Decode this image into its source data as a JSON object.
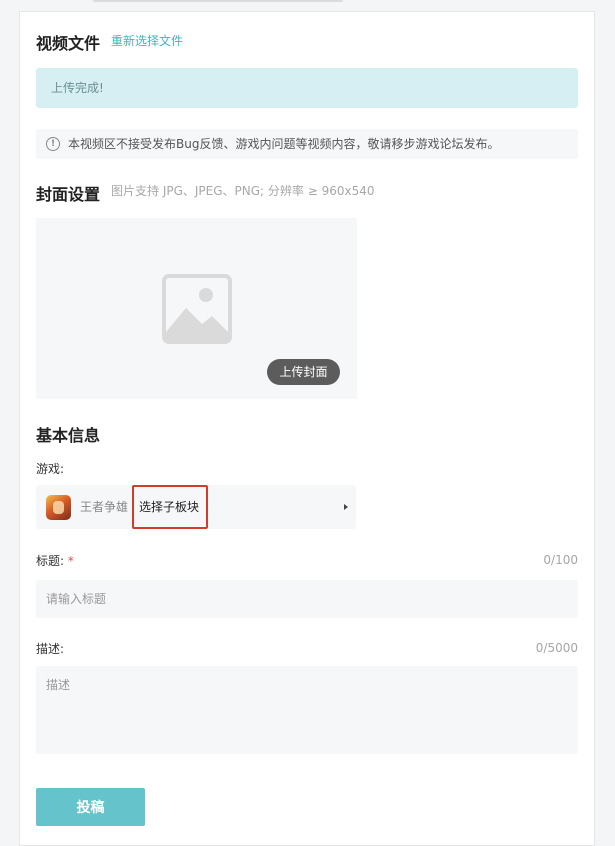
{
  "video": {
    "heading": "视频文件",
    "reselect_link": "重新选择文件",
    "status_message": "上传完成!",
    "notice_icon": "!",
    "notice": "本视频区不接受发布Bug反馈、游戏内问题等视频内容，敬请移步游戏论坛发布。"
  },
  "cover": {
    "heading": "封面设置",
    "hint": "图片支持 JPG、JPEG、PNG; 分辨率 ≥ 960x540",
    "placeholder_icon": "image-placeholder-icon",
    "upload_button": "上传封面"
  },
  "basic": {
    "heading": "基本信息",
    "game_label": "游戏:",
    "game_name": "王者争雄",
    "game_icon": "game-app-icon",
    "subsection_select": "选择子板块",
    "title_label": "标题:",
    "title_required": "*",
    "title_count": "0/100",
    "title_placeholder": "请输入标题",
    "desc_label": "描述:",
    "desc_count": "0/5000",
    "desc_placeholder": "描述"
  },
  "actions": {
    "submit": "投稿"
  },
  "colors": {
    "accent": "#3fb6bf",
    "submit_bg": "#65c3cb",
    "success_bg": "#d5eff2",
    "highlight_border": "#d53a2d"
  }
}
